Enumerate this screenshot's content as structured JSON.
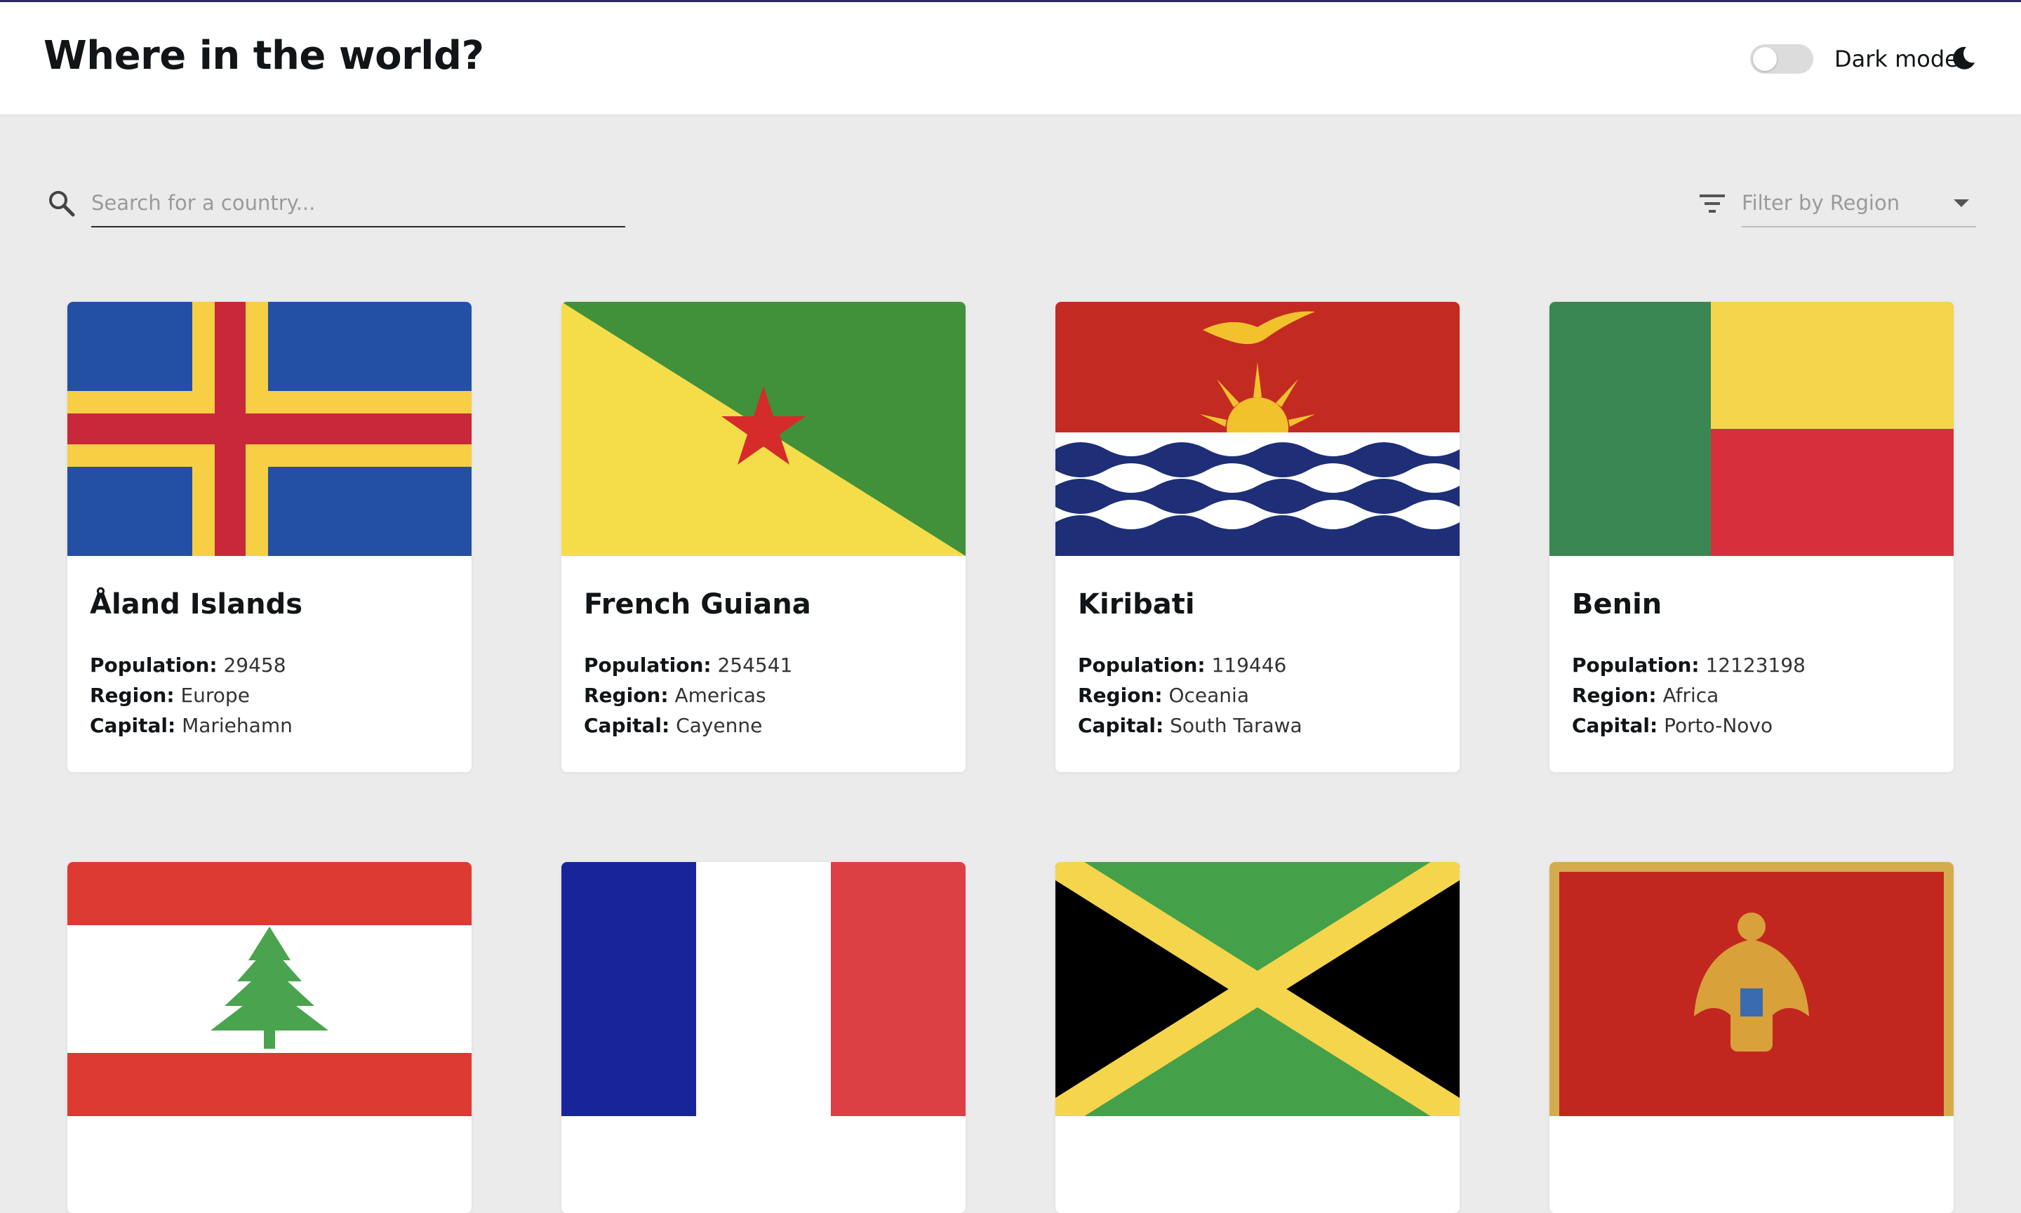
{
  "header": {
    "title": "Where in the world?",
    "dark_mode_label": "Dark mode",
    "dark_mode_on": false
  },
  "search": {
    "placeholder": "Search for a country..."
  },
  "filter": {
    "placeholder": "Filter by Region"
  },
  "labels": {
    "population": "Population:",
    "region": "Region:",
    "capital": "Capital:"
  },
  "countries": [
    {
      "name": "Åland Islands",
      "population": "29458",
      "region": "Europe",
      "capital": "Mariehamn",
      "flag": "aland-flag"
    },
    {
      "name": "French Guiana",
      "population": "254541",
      "region": "Americas",
      "capital": "Cayenne",
      "flag": "french-guiana-flag"
    },
    {
      "name": "Kiribati",
      "population": "119446",
      "region": "Oceania",
      "capital": "South Tarawa",
      "flag": "kiribati-flag"
    },
    {
      "name": "Benin",
      "population": "12123198",
      "region": "Africa",
      "capital": "Porto-Novo",
      "flag": "benin-flag"
    },
    {
      "flag": "lebanon-flag"
    },
    {
      "flag": "france-flag"
    },
    {
      "flag": "jamaica-flag"
    },
    {
      "flag": "montenegro-flag"
    }
  ],
  "colors": {
    "background": "#ebebeb",
    "surface": "#ffffff",
    "text": "#111517",
    "placeholder": "#9a9a9a"
  }
}
